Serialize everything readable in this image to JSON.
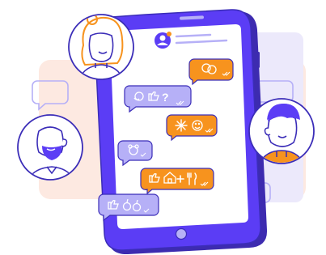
{
  "scene": {
    "description_free": true,
    "palette": {
      "purple": "#5b3df5",
      "purple_dark": "#3d2bb0",
      "lavender": "#b6b0f7",
      "screen": "#ffffff",
      "orange": "#f7931e",
      "peach_bg": "#fde9e1",
      "lilac_bg": "#ece9fb",
      "line": "#3b2db8",
      "skin": "#ffffff",
      "hair_orange": "#f7931e"
    },
    "avatars": [
      {
        "id": "woman-avatar"
      },
      {
        "id": "bearded-man-avatar"
      },
      {
        "id": "man-avatar"
      }
    ],
    "messages": [
      {
        "side": "right",
        "color": "orange",
        "icons": [
          "faces-icon"
        ]
      },
      {
        "side": "left",
        "color": "purple",
        "icons": [
          "thinking-face-icon",
          "thumbs-up-icon",
          "question-icon"
        ]
      },
      {
        "side": "right",
        "color": "orange",
        "icons": [
          "sparkle-icon",
          "smiley-icon"
        ]
      },
      {
        "side": "left",
        "color": "purple",
        "icons": [
          "flower-face-icon"
        ]
      },
      {
        "side": "right",
        "color": "orange",
        "icons": [
          "thumbs-up-icon",
          "house-icon",
          "plus-icon",
          "cutlery-icon"
        ]
      },
      {
        "side": "left",
        "color": "purple",
        "icons": [
          "thumbs-up-icon",
          "apples-icon"
        ]
      }
    ],
    "question_mark": "?"
  }
}
